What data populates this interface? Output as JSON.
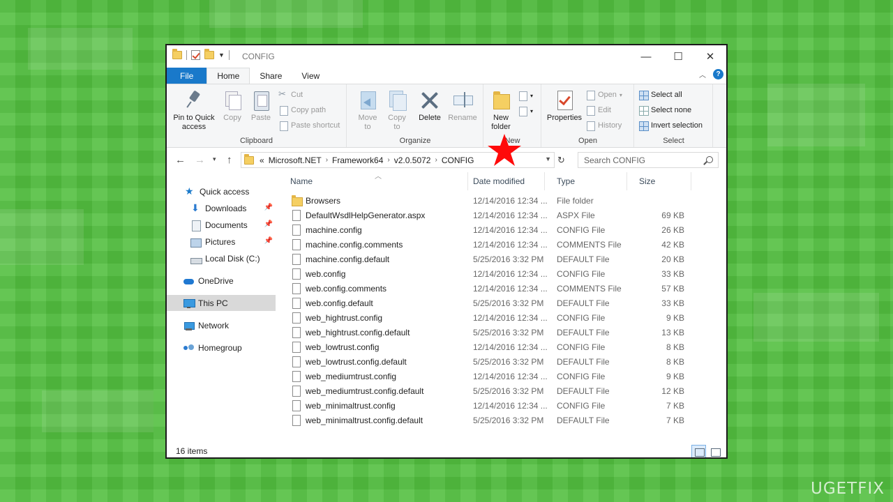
{
  "window": {
    "title": "CONFIG",
    "controls": {
      "minimize": "—",
      "maximize": "☐",
      "close": "✕"
    }
  },
  "ribbon_tabs": [
    "File",
    "Home",
    "Share",
    "View"
  ],
  "ribbon": {
    "clipboard": {
      "label": "Clipboard",
      "pin": "Pin to Quick access",
      "copy": "Copy",
      "paste": "Paste",
      "cut": "Cut",
      "copy_path": "Copy path",
      "paste_shortcut": "Paste shortcut"
    },
    "organize": {
      "label": "Organize",
      "move_to": "Move to",
      "copy_to": "Copy to",
      "delete": "Delete",
      "rename": "Rename"
    },
    "new": {
      "label": "New",
      "new_folder": "New folder"
    },
    "open": {
      "label": "Open",
      "properties": "Properties",
      "open": "Open",
      "edit": "Edit",
      "history": "History"
    },
    "select": {
      "label": "Select",
      "select_all": "Select all",
      "select_none": "Select none",
      "invert": "Invert selection"
    }
  },
  "address": {
    "prefix": "«",
    "crumbs": [
      "Microsoft.NET",
      "Framework64",
      "v2.0.5072",
      "CONFIG"
    ],
    "search_placeholder": "Search CONFIG"
  },
  "nav_pane": [
    {
      "label": "Quick access",
      "icon": "star-icon"
    },
    {
      "label": "Downloads",
      "icon": "download-icon",
      "pinned": true
    },
    {
      "label": "Documents",
      "icon": "documents-icon",
      "pinned": true
    },
    {
      "label": "Pictures",
      "icon": "pictures-icon",
      "pinned": true
    },
    {
      "label": "Local Disk (C:)",
      "icon": "disk-icon"
    },
    {
      "label": "OneDrive",
      "icon": "cloud-icon"
    },
    {
      "label": "This PC",
      "icon": "computer-icon",
      "selected": true
    },
    {
      "label": "Network",
      "icon": "network-icon"
    },
    {
      "label": "Homegroup",
      "icon": "homegroup-icon"
    }
  ],
  "columns": [
    "Name",
    "Date modified",
    "Type",
    "Size"
  ],
  "files": [
    {
      "name": "Browsers",
      "date": "12/14/2016 12:34 ...",
      "type": "File folder",
      "size": "",
      "kind": "folder"
    },
    {
      "name": "DefaultWsdlHelpGenerator.aspx",
      "date": "12/14/2016 12:34 ...",
      "type": "ASPX File",
      "size": "69 KB",
      "kind": "file"
    },
    {
      "name": "machine.config",
      "date": "12/14/2016 12:34 ...",
      "type": "CONFIG File",
      "size": "26 KB",
      "kind": "file"
    },
    {
      "name": "machine.config.comments",
      "date": "12/14/2016 12:34 ...",
      "type": "COMMENTS File",
      "size": "42 KB",
      "kind": "file"
    },
    {
      "name": "machine.config.default",
      "date": "5/25/2016 3:32 PM",
      "type": "DEFAULT File",
      "size": "20 KB",
      "kind": "file"
    },
    {
      "name": "web.config",
      "date": "12/14/2016 12:34 ...",
      "type": "CONFIG File",
      "size": "33 KB",
      "kind": "file"
    },
    {
      "name": "web.config.comments",
      "date": "12/14/2016 12:34 ...",
      "type": "COMMENTS File",
      "size": "57 KB",
      "kind": "file"
    },
    {
      "name": "web.config.default",
      "date": "5/25/2016 3:32 PM",
      "type": "DEFAULT File",
      "size": "33 KB",
      "kind": "file"
    },
    {
      "name": "web_hightrust.config",
      "date": "12/14/2016 12:34 ...",
      "type": "CONFIG File",
      "size": "9 KB",
      "kind": "file"
    },
    {
      "name": "web_hightrust.config.default",
      "date": "5/25/2016 3:32 PM",
      "type": "DEFAULT File",
      "size": "13 KB",
      "kind": "file"
    },
    {
      "name": "web_lowtrust.config",
      "date": "12/14/2016 12:34 ...",
      "type": "CONFIG File",
      "size": "8 KB",
      "kind": "file"
    },
    {
      "name": "web_lowtrust.config.default",
      "date": "5/25/2016 3:32 PM",
      "type": "DEFAULT File",
      "size": "8 KB",
      "kind": "file"
    },
    {
      "name": "web_mediumtrust.config",
      "date": "12/14/2016 12:34 ...",
      "type": "CONFIG File",
      "size": "9 KB",
      "kind": "file"
    },
    {
      "name": "web_mediumtrust.config.default",
      "date": "5/25/2016 3:32 PM",
      "type": "DEFAULT File",
      "size": "12 KB",
      "kind": "file"
    },
    {
      "name": "web_minimaltrust.config",
      "date": "12/14/2016 12:34 ...",
      "type": "CONFIG File",
      "size": "7 KB",
      "kind": "file"
    },
    {
      "name": "web_minimaltrust.config.default",
      "date": "5/25/2016 3:32 PM",
      "type": "DEFAULT File",
      "size": "7 KB",
      "kind": "file"
    }
  ],
  "status": {
    "items": "16 items"
  },
  "brand": {
    "text": "UGETFIX"
  },
  "colors": {
    "file_tab": "#1979ca",
    "selection": "#d9d9d9",
    "background": "#52bf3f",
    "annotation": "#ff0a0a"
  }
}
